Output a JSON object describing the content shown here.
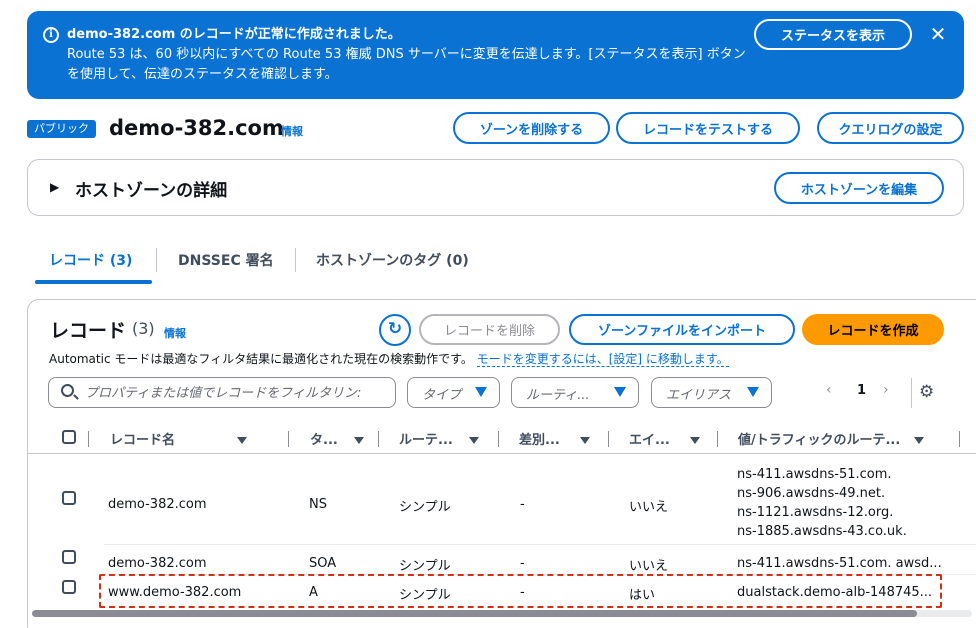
{
  "flash": {
    "title": "demo-382.com のレコードが正常に作成されました。",
    "message": "Route 53 は、60 秒以内にすべての Route 53 権威 DNS サーバーに変更を伝達します。[ステータスを表示] ボタンを使用して、伝達のステータスを確認します。",
    "status_button": "ステータスを表示",
    "close_icon": "✕",
    "info_icon": "i"
  },
  "header": {
    "badge": "パブリック",
    "title": "demo-382.com",
    "info": "情報",
    "delete_zone": "ゾーンを削除する",
    "test_record": "レコードをテストする",
    "query_log": "クエリログの設定"
  },
  "zone_details": {
    "title": "ホストゾーンの詳細",
    "edit_button": "ホストゾーンを編集"
  },
  "tabs": [
    {
      "label": "レコード (3)"
    },
    {
      "label": "DNSSEC 署名"
    },
    {
      "label": "ホストゾーンのタグ (0)"
    }
  ],
  "records": {
    "title": "レコード",
    "count": "(3)",
    "info": "情報",
    "delete_button": "レコードを削除",
    "import_button": "ゾーンファイルをインポート",
    "create_button": "レコードを作成",
    "description": "Automatic モードは最適なフィルタ結果に最適化された現在の検索動作です。",
    "description_link": "モードを変更するには、[設定] に移動します。",
    "search_placeholder": "プロパティまたは値でレコードをフィルタリン:",
    "filters": [
      "タイプ",
      "ルーティ...",
      "エイリアス"
    ],
    "page": "1",
    "columns": [
      "レコード名",
      "タ...",
      "ルーテ...",
      "差別...",
      "エイ...",
      "値/トラフィックのルーテ..."
    ],
    "rows": [
      {
        "name": "demo-382.com",
        "type": "NS",
        "routing": "シンプル",
        "diff": "-",
        "alias": "いいえ",
        "values": [
          "ns-411.awsdns-51.com.",
          "ns-906.awsdns-49.net.",
          "ns-1121.awsdns-12.org.",
          "ns-1885.awsdns-43.co.uk."
        ]
      },
      {
        "name": "demo-382.com",
        "type": "SOA",
        "routing": "シンプル",
        "diff": "-",
        "alias": "いいえ",
        "value": "ns-411.awsdns-51.com. awsd..."
      },
      {
        "name": "www.demo-382.com",
        "type": "A",
        "routing": "シンプル",
        "diff": "-",
        "alias": "はい",
        "value": "dualstack.demo-alb-148745..."
      }
    ]
  },
  "colors": {
    "primary": "#0972d3",
    "create": "#ff9900",
    "highlight": "#d13212"
  }
}
